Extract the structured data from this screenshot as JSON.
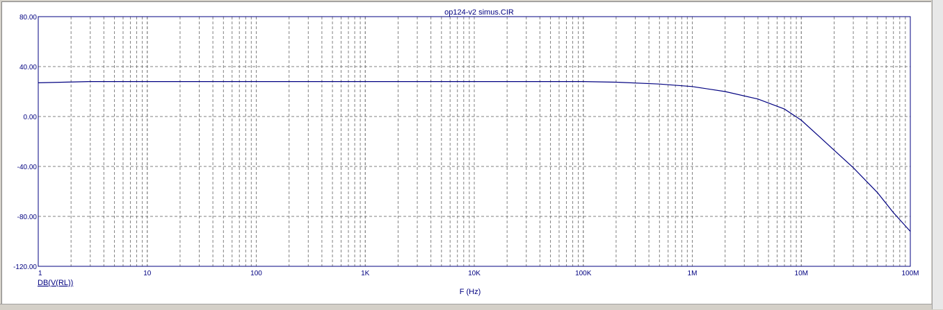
{
  "chart_data": {
    "type": "line",
    "title": "op124-v2 simus.CIR",
    "xlabel": "F (Hz)",
    "xscale": "log",
    "xlim": [
      1,
      100000000
    ],
    "ylim": [
      -120,
      80
    ],
    "grid": true,
    "x_tick_values": [
      1,
      10,
      100,
      1000,
      10000,
      100000,
      1000000,
      10000000,
      100000000
    ],
    "x_tick_labels": [
      "1",
      "10",
      "100",
      "1K",
      "10K",
      "100K",
      "1M",
      "10M",
      "100M"
    ],
    "y_tick_values": [
      80,
      40,
      0,
      -40,
      -80,
      -120
    ],
    "y_tick_labels": [
      "80.00",
      "40.00",
      "0.00",
      "-40.00",
      "-80.00",
      "-120.00"
    ],
    "series": [
      {
        "name": "DB(V(RL))",
        "color": "#000080",
        "x": [
          1,
          3,
          10,
          100,
          1000,
          10000,
          100000,
          200000,
          500000,
          1000000,
          2000000,
          4000000,
          7000000,
          10000000,
          15000000,
          20000000,
          30000000,
          50000000,
          70000000,
          100000000
        ],
        "y": [
          27,
          28,
          28,
          28,
          28,
          28,
          28,
          27.5,
          26,
          24,
          20,
          14,
          6,
          -3,
          -17,
          -27,
          -41,
          -61,
          -77,
          -92
        ]
      }
    ]
  },
  "colors": {
    "axis": "#000080",
    "grid": "#808080",
    "curve": "#000080",
    "background": "#ffffff",
    "frame": "#d4d0c8"
  }
}
